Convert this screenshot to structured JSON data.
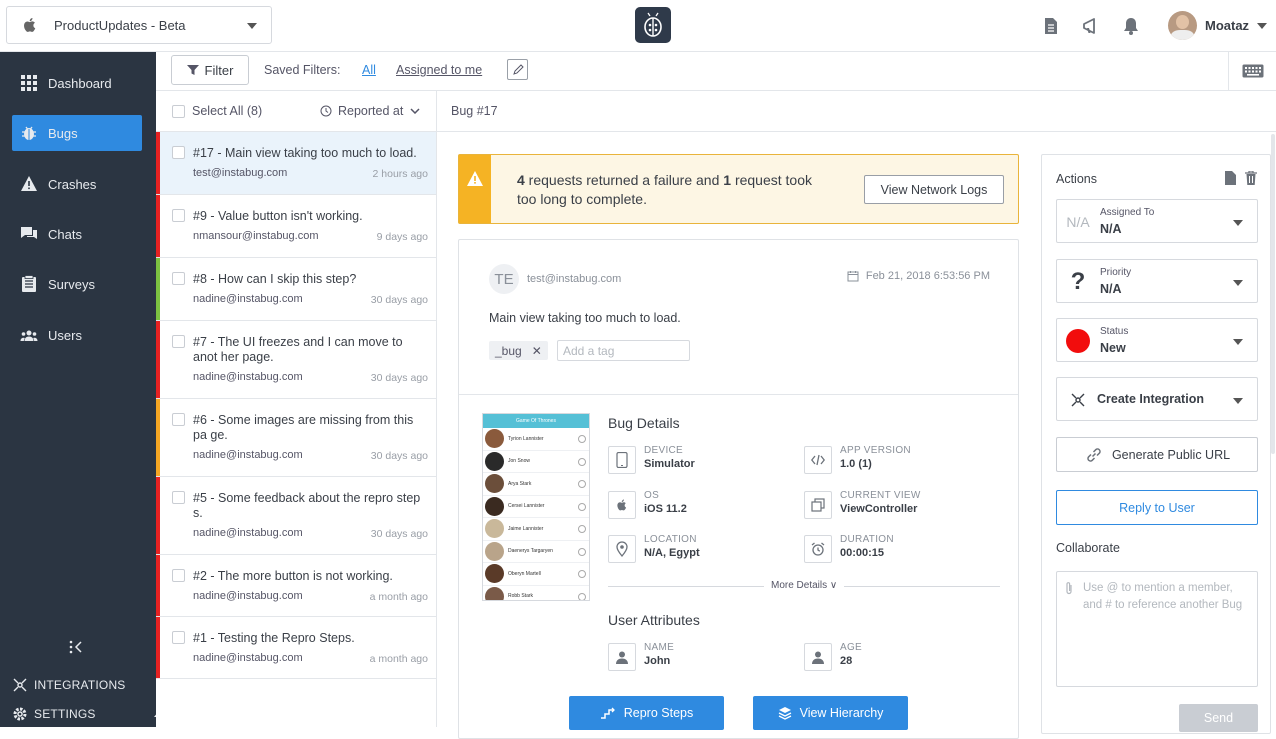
{
  "app": {
    "selector_label": "ProductUpdates - Beta"
  },
  "user": {
    "name": "Moataz"
  },
  "sidebar": {
    "items": [
      {
        "label": "Dashboard",
        "icon": "grid-icon"
      },
      {
        "label": "Bugs",
        "icon": "bug-icon"
      },
      {
        "label": "Crashes",
        "icon": "warning-icon"
      },
      {
        "label": "Chats",
        "icon": "chat-icon"
      },
      {
        "label": "Surveys",
        "icon": "survey-icon"
      },
      {
        "label": "Users",
        "icon": "users-icon"
      }
    ],
    "integrations_label": "INTEGRATIONS",
    "settings_label": "SETTINGS"
  },
  "filterbar": {
    "filter_label": "Filter",
    "saved_filters_label": "Saved Filters:",
    "all_label": "All",
    "assigned_label": "Assigned to me"
  },
  "list": {
    "select_all": "Select All (8)",
    "sort_label": "Reported at",
    "items": [
      {
        "title": "#17 - Main view taking too much to load.",
        "email": "test@instabug.com",
        "time": "2 hours ago",
        "color": "#e62222"
      },
      {
        "title": "#9 - Value button isn't working.",
        "email": "nmansour@instabug.com",
        "time": "9 days ago",
        "color": "#e62222"
      },
      {
        "title": "#8 - How can I skip this step?",
        "email": "nadine@instabug.com",
        "time": "30 days ago",
        "color": "#7cc241"
      },
      {
        "title": "#7 - The UI freezes and I can move to anot her page.",
        "email": "nadine@instabug.com",
        "time": "30 days ago",
        "color": "#e62222"
      },
      {
        "title": "#6 - Some images are missing from this pa ge.",
        "email": "nadine@instabug.com",
        "time": "30 days ago",
        "color": "#f5a623"
      },
      {
        "title": "#5 - Some feedback about the repro step s.",
        "email": "nadine@instabug.com",
        "time": "30 days ago",
        "color": "#e62222"
      },
      {
        "title": "#2 - The more button is not working.",
        "email": "nadine@instabug.com",
        "time": "a month ago",
        "color": "#e62222"
      },
      {
        "title": "#1 - Testing the Repro Steps.",
        "email": "nadine@instabug.com",
        "time": "a month ago",
        "color": "#e62222"
      }
    ]
  },
  "detail": {
    "header": "Bug #17",
    "warning": {
      "count1": "4",
      "text1": " requests returned a failure and ",
      "count2": "1",
      "text2": " request took too long to complete.",
      "button": "View Network Logs"
    },
    "reporter": {
      "initials": "TE",
      "email": "test@instabug.com",
      "date": "Feb 21, 2018 6:53:56 PM"
    },
    "message": "Main view taking too much to load.",
    "tag": "_bug",
    "tag_placeholder": "Add a tag",
    "phone": {
      "title": "Game Of Thrones",
      "rows": [
        "Tyrion Lannister",
        "Jon Snow",
        "Arya Stark",
        "Cersei Lannister",
        "Jaime Lannister",
        "Daenerys Targaryen",
        "Oberyn Martell",
        "Robb Stark"
      ]
    },
    "bug_details_title": "Bug Details",
    "attrs": [
      {
        "label": "DEVICE",
        "value": "Simulator"
      },
      {
        "label": "APP VERSION",
        "value": "1.0 (1)"
      },
      {
        "label": "OS",
        "value": "iOS 11.2"
      },
      {
        "label": "CURRENT VIEW",
        "value": "ViewController"
      },
      {
        "label": "LOCATION",
        "value": "N/A, Egypt"
      },
      {
        "label": "DURATION",
        "value": "00:00:15"
      }
    ],
    "more_details": "More Details",
    "user_attributes_title": "User Attributes",
    "user_attrs": [
      {
        "label": "NAME",
        "value": "John"
      },
      {
        "label": "AGE",
        "value": "28"
      }
    ],
    "repro_button": "Repro Steps",
    "hierarchy_button": "View Hierarchy"
  },
  "actions": {
    "title": "Actions",
    "assigned": {
      "label": "Assigned To",
      "value": "N/A",
      "icon_text": "N/A"
    },
    "priority": {
      "label": "Priority",
      "value": "N/A"
    },
    "status": {
      "label": "Status",
      "value": "New"
    },
    "integration": "Create Integration",
    "public_url": "Generate Public URL",
    "reply": "Reply to User",
    "collaborate": "Collaborate",
    "collab_placeholder": "Use @ to mention a member, and # to reference another Bug",
    "send": "Send"
  }
}
